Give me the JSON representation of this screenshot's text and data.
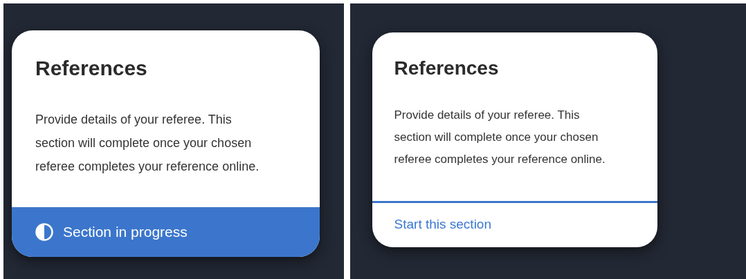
{
  "panels": [
    {
      "title": "References",
      "description": [
        "Provide details of your referee. This",
        "section will complete once your chosen",
        "referee completes your reference online."
      ],
      "footer": {
        "kind": "status",
        "label": "Section in progress"
      }
    },
    {
      "title": "References",
      "description": [
        "Provide details of your referee. This",
        "section will complete once your chosen",
        "referee completes your reference online."
      ],
      "footer": {
        "kind": "link",
        "label": "Start this section"
      }
    }
  ]
}
